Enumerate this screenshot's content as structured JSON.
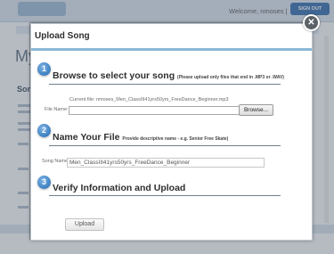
{
  "background": {
    "header": {
      "welcome_text": "Welcome, nmoses |",
      "signout_label": "SIGN OUT"
    },
    "page_heading": "My",
    "subheading": "Son"
  },
  "modal": {
    "title": "Upload Song",
    "close_glyph": "✕",
    "step1": {
      "number": "1",
      "title": "Browse to select your song",
      "hint": "(Please upload only files that end in .MP3 or .WAV)",
      "current_file_label": "Current file:",
      "current_file_value": "nmoses_Men_ClassIII41yrs50yrs_FreeDance_Beginner.mp3",
      "file_name_label": "File Name:",
      "file_name_value": "",
      "browse_label": "Browse..."
    },
    "step2": {
      "number": "2",
      "title": "Name Your File",
      "hint": "Provide descriptive name - e.g. Senior Free Skate)",
      "song_name_label": "Song Name:",
      "song_name_value": "Men_ClassIII41yrs50yrs_FreeDance_Beginner"
    },
    "step3": {
      "number": "3",
      "title": "Verify Information and Upload",
      "upload_label": "Upload"
    }
  },
  "colors": {
    "step_circle": "#3a7fc0",
    "title_rule": "#8ab7d8",
    "overlay": "#2d3c50",
    "signout_bg": "#4a7fb8"
  }
}
